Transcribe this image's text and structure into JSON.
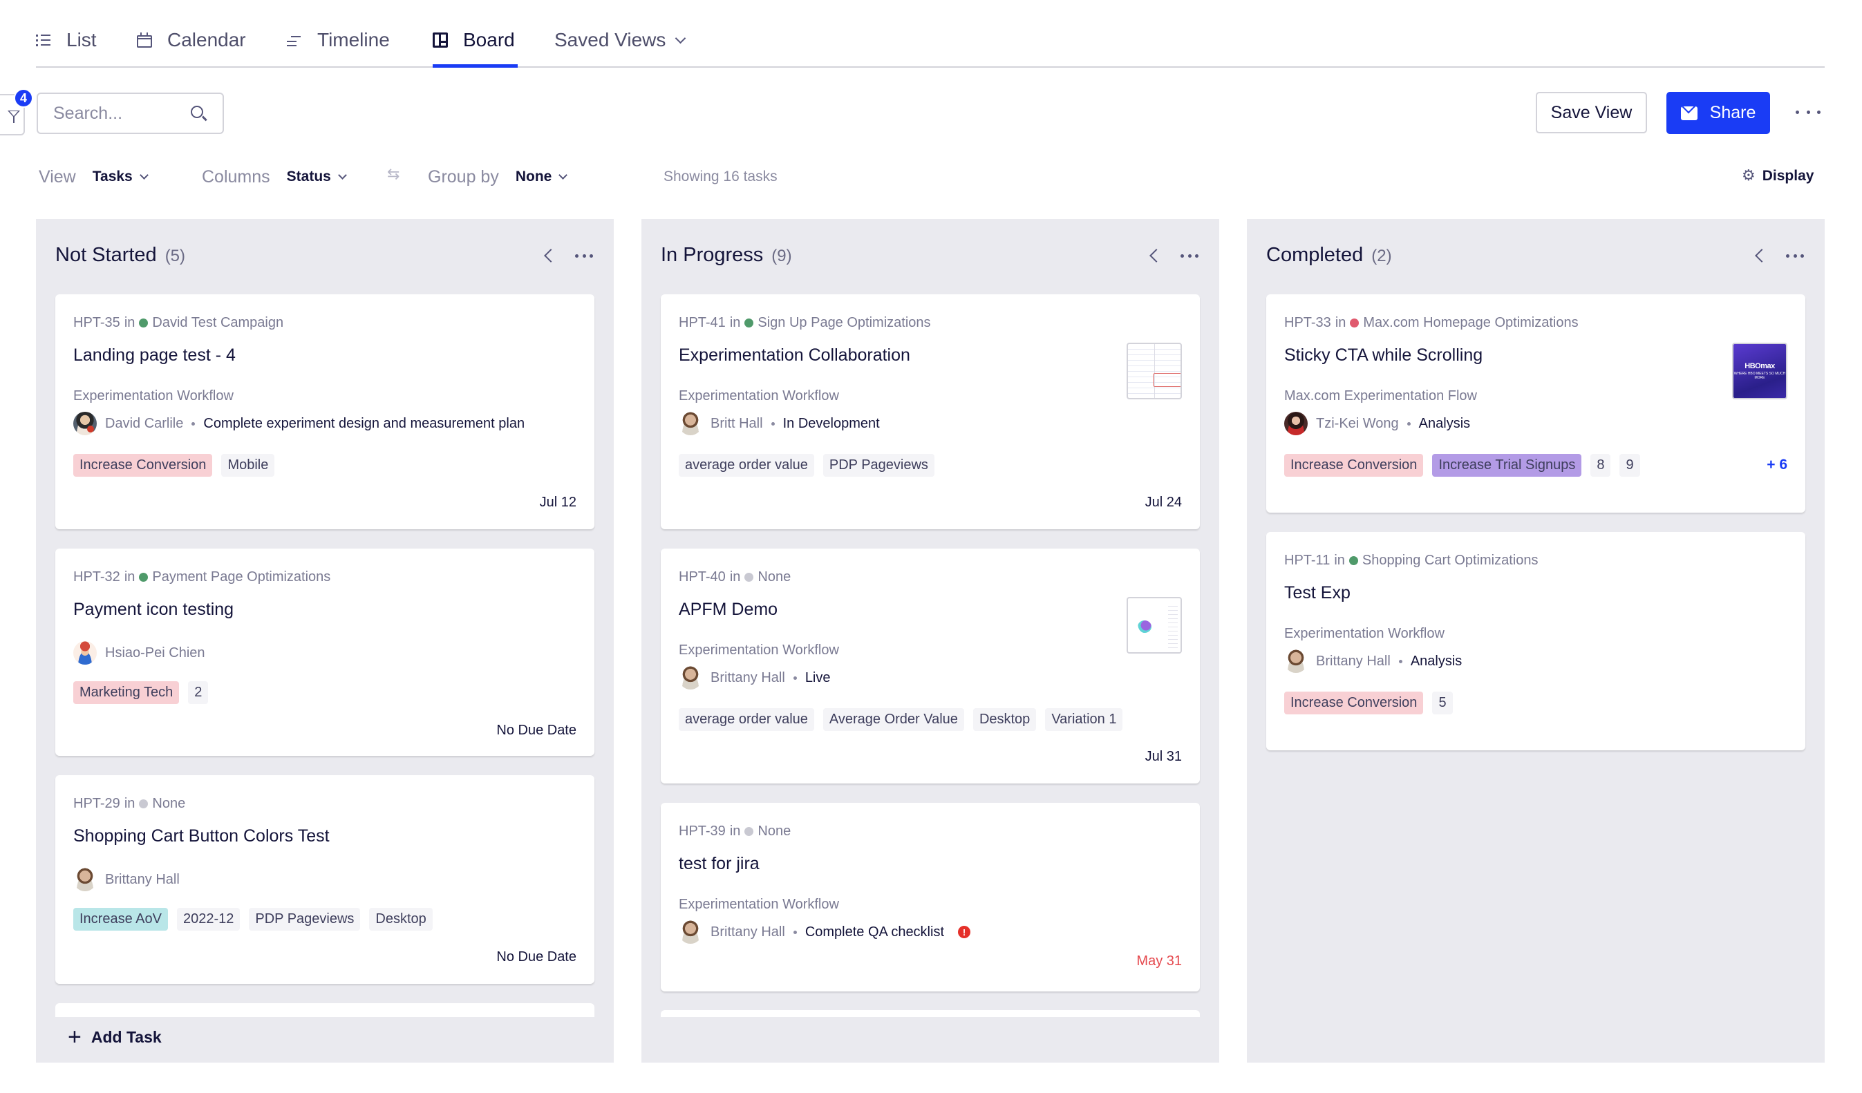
{
  "tabs": [
    {
      "label": "List",
      "icon": "list-icon"
    },
    {
      "label": "Calendar",
      "icon": "calendar-icon"
    },
    {
      "label": "Timeline",
      "icon": "timeline-icon"
    },
    {
      "label": "Board",
      "icon": "board-icon",
      "active": true
    },
    {
      "label": "Saved Views",
      "icon": "chevron-down-icon"
    }
  ],
  "toolbar": {
    "filter_count": "4",
    "search_placeholder": "Search...",
    "save_view_label": "Save View",
    "share_label": "Share"
  },
  "view_bar": {
    "view_label": "View",
    "view_value": "Tasks",
    "columns_label": "Columns",
    "columns_value": "Status",
    "group_by_label": "Group by",
    "group_by_value": "None",
    "showing_text": "Showing 16 tasks",
    "display_label": "Display"
  },
  "colors": {
    "accent": "#1a3cf5",
    "column_bg": "#eaeaef",
    "overdue": "#e5484d",
    "project_green": "#4f9a6a",
    "project_red": "#e05a6e",
    "project_none": "#c9c9d2"
  },
  "columns": [
    {
      "title": "Not Started",
      "count": "(5)",
      "add_task_label": "Add Task",
      "cards": [
        {
          "id": "HPT-35",
          "in": "in",
          "project": "David Test Campaign",
          "project_color": "#4f9a6a",
          "title": "Landing page test - 4",
          "workflow": "Experimentation Workflow",
          "assignee": "David Carlile",
          "step": "Complete experiment design and measurement plan",
          "tags": [
            {
              "label": "Increase Conversion",
              "style": "pink"
            },
            {
              "label": "Mobile",
              "style": "gray"
            }
          ],
          "due": "Jul 12"
        },
        {
          "id": "HPT-32",
          "in": "in",
          "project": "Payment Page Optimizations",
          "project_color": "#4f9a6a",
          "title": "Payment icon testing",
          "assignee": "Hsiao-Pei Chien",
          "tags": [
            {
              "label": "Marketing Tech",
              "style": "pink"
            },
            {
              "label": "2",
              "style": "gray"
            }
          ],
          "due": "No Due Date"
        },
        {
          "id": "HPT-29",
          "in": "in",
          "project": "None",
          "project_color": "#c9c9d2",
          "title": "Shopping Cart Button Colors Test",
          "assignee": "Brittany Hall",
          "tags": [
            {
              "label": "Increase AoV",
              "style": "teal"
            },
            {
              "label": "2022-12",
              "style": "gray"
            },
            {
              "label": "PDP Pageviews",
              "style": "gray"
            },
            {
              "label": "Desktop",
              "style": "gray"
            }
          ],
          "due": "No Due Date"
        }
      ]
    },
    {
      "title": "In Progress",
      "count": "(9)",
      "cards": [
        {
          "id": "HPT-41",
          "in": "in",
          "project": "Sign Up Page Optimizations",
          "project_color": "#4f9a6a",
          "title": "Experimentation Collaboration",
          "workflow": "Experimentation Workflow",
          "assignee": "Britt Hall",
          "step": "In Development",
          "tags": [
            {
              "label": "average order value",
              "style": "gray"
            },
            {
              "label": "PDP Pageviews",
              "style": "gray"
            }
          ],
          "due": "Jul 24",
          "thumbnail": "document-screenshot"
        },
        {
          "id": "HPT-40",
          "in": "in",
          "project": "None",
          "project_color": "#c9c9d2",
          "title": "APFM Demo",
          "workflow": "Experimentation Workflow",
          "assignee": "Brittany Hall",
          "step": "Live",
          "tags": [
            {
              "label": "average order value",
              "style": "gray"
            },
            {
              "label": "Average Order Value",
              "style": "gray"
            },
            {
              "label": "Desktop",
              "style": "gray"
            },
            {
              "label": "Variation 1",
              "style": "gray"
            }
          ],
          "due": "Jul 31",
          "thumbnail": "chart-screenshot"
        },
        {
          "id": "HPT-39",
          "in": "in",
          "project": "None",
          "project_color": "#c9c9d2",
          "title": "test for jira",
          "workflow": "Experimentation Workflow",
          "assignee": "Brittany Hall",
          "step": "Complete QA checklist",
          "alert": "!",
          "due": "May 31",
          "due_overdue": true
        }
      ]
    },
    {
      "title": "Completed",
      "count": "(2)",
      "cards": [
        {
          "id": "HPT-33",
          "in": "in",
          "project": "Max.com Homepage Optimizations",
          "project_color": "#e05a6e",
          "title": "Sticky CTA while Scrolling",
          "workflow": "Max.com Experimentation Flow",
          "assignee": "Tzi-Kei Wong",
          "step": "Analysis",
          "tags": [
            {
              "label": "Increase Conversion",
              "style": "pink"
            },
            {
              "label": "Increase Trial Signups",
              "style": "purple"
            },
            {
              "label": "8",
              "style": "gray"
            },
            {
              "label": "9",
              "style": "gray"
            }
          ],
          "more_tags": "+ 6",
          "thumbnail": "hbomax-banner",
          "thumbnail_text": {
            "logo": "HBOmax",
            "tagline": "WHERE HBO MEETS SO MUCH MORE"
          }
        },
        {
          "id": "HPT-11",
          "in": "in",
          "project": "Shopping Cart Optimizations",
          "project_color": "#4f9a6a",
          "title": "Test Exp",
          "workflow": "Experimentation Workflow",
          "assignee": "Brittany Hall",
          "step": "Analysis",
          "tags": [
            {
              "label": "Increase Conversion",
              "style": "pink"
            },
            {
              "label": "5",
              "style": "gray"
            }
          ]
        }
      ]
    }
  ]
}
